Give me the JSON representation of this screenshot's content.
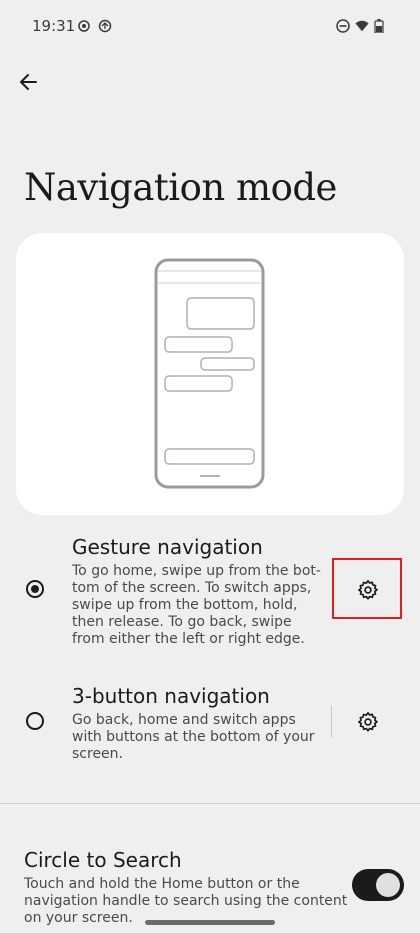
{
  "status_bar": {
    "time": "19:31",
    "icons": [
      "location-icon",
      "sync-icon",
      "do-not-disturb-icon",
      "wifi-icon",
      "battery-icon"
    ]
  },
  "header": {
    "back_icon": "arrow-left-icon",
    "title": "Navigation mode"
  },
  "options": [
    {
      "title": "Gesture navigation",
      "desc_lines": [
        "To go home, swipe up from the bot-",
        "tom of the screen. To switch apps,",
        "swipe up from the bottom, hold,",
        "then release. To go back, swipe",
        "from either the left or right edge."
      ],
      "selected": true,
      "settings_icon": "gear-icon"
    },
    {
      "title": "3-button navigation",
      "desc_lines": [
        "Go back, home and switch apps",
        "with buttons at the bottom of your",
        "screen."
      ],
      "selected": false,
      "settings_icon": "gear-icon"
    }
  ],
  "circle_to_search": {
    "title": "Circle to Search",
    "desc_lines": [
      "Touch and hold the Home button or the",
      "navigation handle to search using the content",
      "on your screen."
    ],
    "enabled": true
  },
  "colors": {
    "background": "#efefef",
    "card": "#ffffff",
    "text": "#1b1b1b",
    "highlight": "#e02020"
  }
}
